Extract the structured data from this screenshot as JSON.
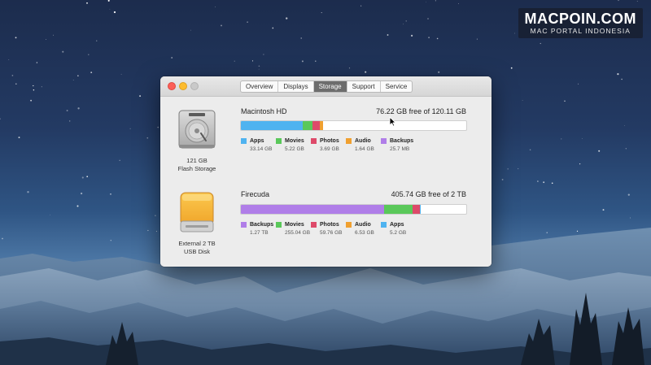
{
  "watermark": {
    "title": "MACPOIN.COM",
    "subtitle": "MAC PORTAL INDONESIA"
  },
  "window": {
    "tabs": [
      {
        "label": "Overview",
        "active": false
      },
      {
        "label": "Displays",
        "active": false
      },
      {
        "label": "Storage",
        "active": true
      },
      {
        "label": "Support",
        "active": false
      },
      {
        "label": "Service",
        "active": false
      }
    ]
  },
  "colors": {
    "apps": "#4fb3f0",
    "movies": "#5ac85a",
    "photos": "#de4a6a",
    "audio": "#f0a030",
    "backups": "#b07ee8"
  },
  "drives": [
    {
      "name": "Macintosh HD",
      "free_text": "76.22 GB free of 120.11 GB",
      "label_line1": "121 GB",
      "label_line2": "Flash Storage",
      "icon": "internal-drive-icon",
      "segments": [
        {
          "key": "apps",
          "fraction": 0.276
        },
        {
          "key": "movies",
          "fraction": 0.043
        },
        {
          "key": "photos",
          "fraction": 0.031
        },
        {
          "key": "audio",
          "fraction": 0.015
        },
        {
          "key": "backups",
          "fraction": 0.0002
        }
      ],
      "legend": [
        {
          "key": "apps",
          "name": "Apps",
          "size": "33.14 GB"
        },
        {
          "key": "movies",
          "name": "Movies",
          "size": "5.22 GB"
        },
        {
          "key": "photos",
          "name": "Photos",
          "size": "3.69 GB"
        },
        {
          "key": "audio",
          "name": "Audio",
          "size": "1.64 GB"
        },
        {
          "key": "backups",
          "name": "Backups",
          "size": "25.7 MB"
        }
      ]
    },
    {
      "name": "Firecuda",
      "free_text": "405.74 GB free of 2 TB",
      "label_line1": "External 2 TB",
      "label_line2": "USB Disk",
      "icon": "external-drive-icon",
      "segments": [
        {
          "key": "backups",
          "fraction": 0.635
        },
        {
          "key": "movies",
          "fraction": 0.128
        },
        {
          "key": "photos",
          "fraction": 0.03
        },
        {
          "key": "audio",
          "fraction": 0.003
        },
        {
          "key": "apps",
          "fraction": 0.003
        }
      ],
      "legend": [
        {
          "key": "backups",
          "name": "Backups",
          "size": "1.27 TB"
        },
        {
          "key": "movies",
          "name": "Movies",
          "size": "255.04 GB"
        },
        {
          "key": "photos",
          "name": "Photos",
          "size": "59.76 GB"
        },
        {
          "key": "audio",
          "name": "Audio",
          "size": "6.53 GB"
        },
        {
          "key": "apps",
          "name": "Apps",
          "size": "5.2 GB"
        }
      ]
    }
  ]
}
